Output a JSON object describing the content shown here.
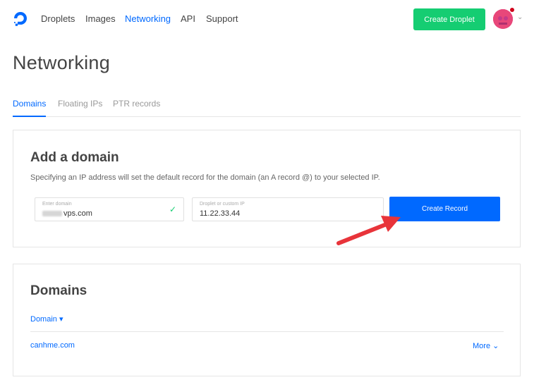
{
  "nav": {
    "items": [
      "Droplets",
      "Images",
      "Networking",
      "API",
      "Support"
    ],
    "active": "Networking",
    "create_button": "Create Droplet"
  },
  "page": {
    "title": "Networking"
  },
  "tabs": {
    "items": [
      "Domains",
      "Floating IPs",
      "PTR records"
    ],
    "active": "Domains"
  },
  "add_domain": {
    "title": "Add a domain",
    "description": "Specifying an IP address will set the default record for the domain (an A record @) to your selected IP.",
    "domain_field": {
      "label": "Enter domain",
      "value": "vps.com"
    },
    "ip_field": {
      "label": "Droplet or custom IP",
      "value": "11.22.33.44"
    },
    "submit_label": "Create Record"
  },
  "domains": {
    "title": "Domains",
    "sort_label": "Domain",
    "rows": [
      {
        "name": "canhme.com",
        "action": "More"
      }
    ]
  },
  "colors": {
    "accent": "#0069ff",
    "success": "#15cd72",
    "annotation_arrow": "#e8343a"
  }
}
